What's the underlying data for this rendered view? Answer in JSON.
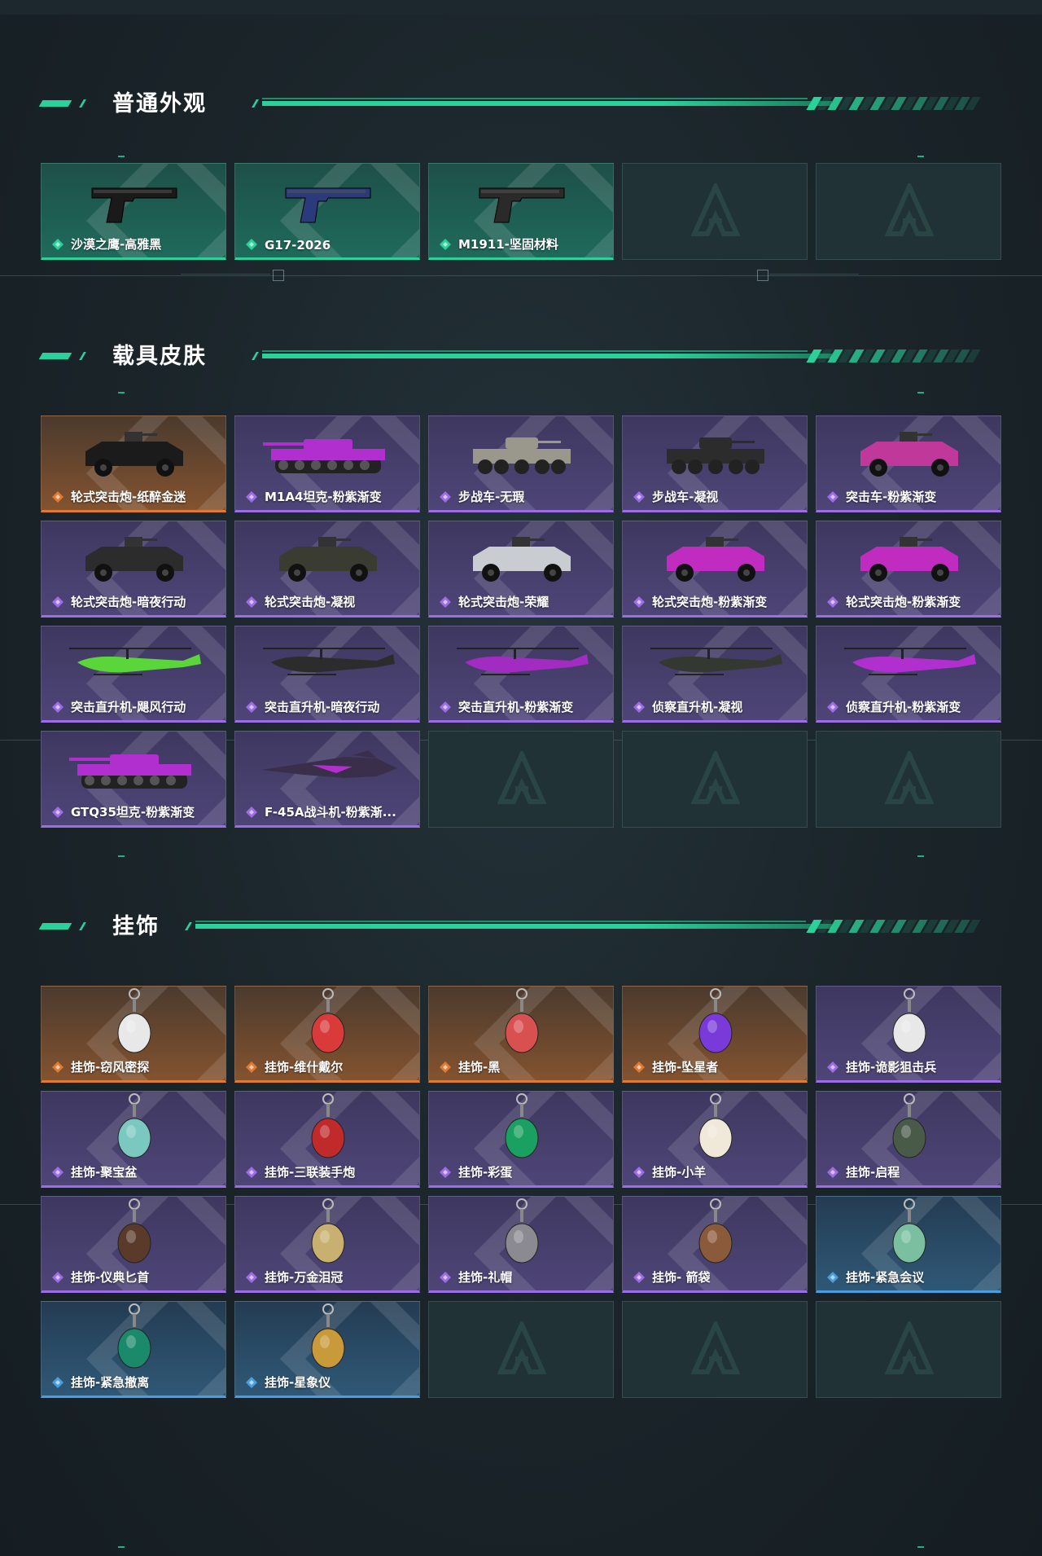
{
  "sections": [
    {
      "title": "普通外观",
      "items": [
        {
          "label": "沙漠之鹰-高雅黑",
          "rarity": "green",
          "icon": "pistol-icon",
          "color": "#1a1a1a"
        },
        {
          "label": "G17-2026",
          "rarity": "green",
          "icon": "pistol-icon",
          "color": "#2b3a7a"
        },
        {
          "label": "M1911-坚固材料",
          "rarity": "green",
          "icon": "pistol-icon",
          "color": "#2a2a2a"
        },
        {
          "label": "",
          "rarity": "empty",
          "icon": "empty-slot-logo-icon",
          "color": ""
        },
        {
          "label": "",
          "rarity": "empty",
          "icon": "empty-slot-logo-icon",
          "color": ""
        }
      ]
    },
    {
      "title": "载具皮肤",
      "items": [
        {
          "label": "轮式突击炮-纸醉金迷",
          "rarity": "orange",
          "icon": "armored-car-icon",
          "color": "#1b1b1b"
        },
        {
          "label": "M1A4坦克-粉紫渐变",
          "rarity": "purple",
          "icon": "tank-icon",
          "color": "#b12fcf"
        },
        {
          "label": "步战车-无瑕",
          "rarity": "purple",
          "icon": "ifv-icon",
          "color": "#9a978c"
        },
        {
          "label": "步战车-凝视",
          "rarity": "purple",
          "icon": "ifv-icon",
          "color": "#2c2c2c"
        },
        {
          "label": "突击车-粉紫渐变",
          "rarity": "purple",
          "icon": "assault-car-icon",
          "color": "#c0399a"
        },
        {
          "label": "轮式突击炮-暗夜行动",
          "rarity": "purple",
          "icon": "armored-car-icon",
          "color": "#2c2c2c"
        },
        {
          "label": "轮式突击炮-凝视",
          "rarity": "purple",
          "icon": "armored-car-icon",
          "color": "#3a3c32"
        },
        {
          "label": "轮式突击炮-荣耀",
          "rarity": "purple",
          "icon": "armored-car-icon",
          "color": "#c9ccd0"
        },
        {
          "label": "轮式突击炮-粉紫渐变",
          "rarity": "purple",
          "icon": "armored-car-icon",
          "color": "#c02cc0"
        },
        {
          "label": "轮式突击炮-粉紫渐变",
          "rarity": "purple",
          "icon": "armored-car-icon",
          "color": "#c02cc0"
        },
        {
          "label": "突击直升机-飓风行动",
          "rarity": "purple",
          "icon": "helicopter-icon",
          "color": "#5bd63a"
        },
        {
          "label": "突击直升机-暗夜行动",
          "rarity": "purple",
          "icon": "helicopter-icon",
          "color": "#2c2c2c"
        },
        {
          "label": "突击直升机-粉紫渐变",
          "rarity": "purple",
          "icon": "helicopter-icon",
          "color": "#a22bc2"
        },
        {
          "label": "侦察直升机-凝视",
          "rarity": "purple",
          "icon": "helicopter-icon",
          "color": "#353830"
        },
        {
          "label": "侦察直升机-粉紫渐变",
          "rarity": "purple",
          "icon": "helicopter-icon",
          "color": "#b12fcf"
        },
        {
          "label": "GTQ35坦克-粉紫渐变",
          "rarity": "purple",
          "icon": "tank-icon",
          "color": "#b12fcf"
        },
        {
          "label": "F-45A战斗机-粉紫渐...",
          "rarity": "purple",
          "icon": "fighter-jet-icon",
          "color": "#3a2f4a"
        },
        {
          "label": "",
          "rarity": "empty",
          "icon": "empty-slot-logo-icon",
          "color": ""
        },
        {
          "label": "",
          "rarity": "empty",
          "icon": "empty-slot-logo-icon",
          "color": ""
        },
        {
          "label": "",
          "rarity": "empty",
          "icon": "empty-slot-logo-icon",
          "color": ""
        }
      ]
    },
    {
      "title": "挂饰",
      "items": [
        {
          "label": "挂饰-窃风密探",
          "rarity": "orange",
          "icon": "charm-icon",
          "color": "#e8e8e8"
        },
        {
          "label": "挂饰-维什戴尔",
          "rarity": "orange",
          "icon": "charm-icon",
          "color": "#d93a3a"
        },
        {
          "label": "挂饰-黑",
          "rarity": "orange",
          "icon": "charm-icon",
          "color": "#d95050"
        },
        {
          "label": "挂饰-坠星者",
          "rarity": "orange",
          "icon": "charm-icon",
          "color": "#7a3ad9"
        },
        {
          "label": "挂饰-诡影狙击兵",
          "rarity": "purple",
          "icon": "charm-icon",
          "color": "#e8e8e8"
        },
        {
          "label": "挂饰-聚宝盆",
          "rarity": "purple",
          "icon": "charm-icon",
          "color": "#7ac8c0"
        },
        {
          "label": "挂饰-三联装手炮",
          "rarity": "purple",
          "icon": "charm-icon",
          "color": "#c02a2a"
        },
        {
          "label": "挂饰-彩蛋",
          "rarity": "purple",
          "icon": "charm-icon",
          "color": "#1aa060"
        },
        {
          "label": "挂饰-小羊",
          "rarity": "purple",
          "icon": "charm-icon",
          "color": "#f0e8d8"
        },
        {
          "label": "挂饰-启程",
          "rarity": "purple",
          "icon": "charm-icon",
          "color": "#4a5a48"
        },
        {
          "label": "挂饰-仪典匕首",
          "rarity": "purple",
          "icon": "charm-icon",
          "color": "#5a3a2a"
        },
        {
          "label": "挂饰-万金泪冠",
          "rarity": "purple",
          "icon": "charm-icon",
          "color": "#c8b070"
        },
        {
          "label": "挂饰-礼帽",
          "rarity": "purple",
          "icon": "charm-icon",
          "color": "#8a8a90"
        },
        {
          "label": "挂饰- 箭袋",
          "rarity": "purple",
          "icon": "charm-icon",
          "color": "#8a5a3a"
        },
        {
          "label": "挂饰-紧急会议",
          "rarity": "blue",
          "icon": "charm-icon",
          "color": "#7ac0a0"
        },
        {
          "label": "挂饰-紧急撤离",
          "rarity": "blue",
          "icon": "charm-icon",
          "color": "#1a8a6a"
        },
        {
          "label": "挂饰-星象仪",
          "rarity": "blue",
          "icon": "charm-icon",
          "color": "#c89a3a"
        },
        {
          "label": "",
          "rarity": "empty",
          "icon": "empty-slot-logo-icon",
          "color": ""
        },
        {
          "label": "",
          "rarity": "empty",
          "icon": "empty-slot-logo-icon",
          "color": ""
        },
        {
          "label": "",
          "rarity": "empty",
          "icon": "empty-slot-logo-icon",
          "color": ""
        }
      ]
    }
  ],
  "colors": {
    "accent": "#2ad19a",
    "rarity_green": "#2ad19a",
    "rarity_purple": "#9c6de6",
    "rarity_orange": "#e07a32",
    "rarity_blue": "#4a9de0"
  }
}
